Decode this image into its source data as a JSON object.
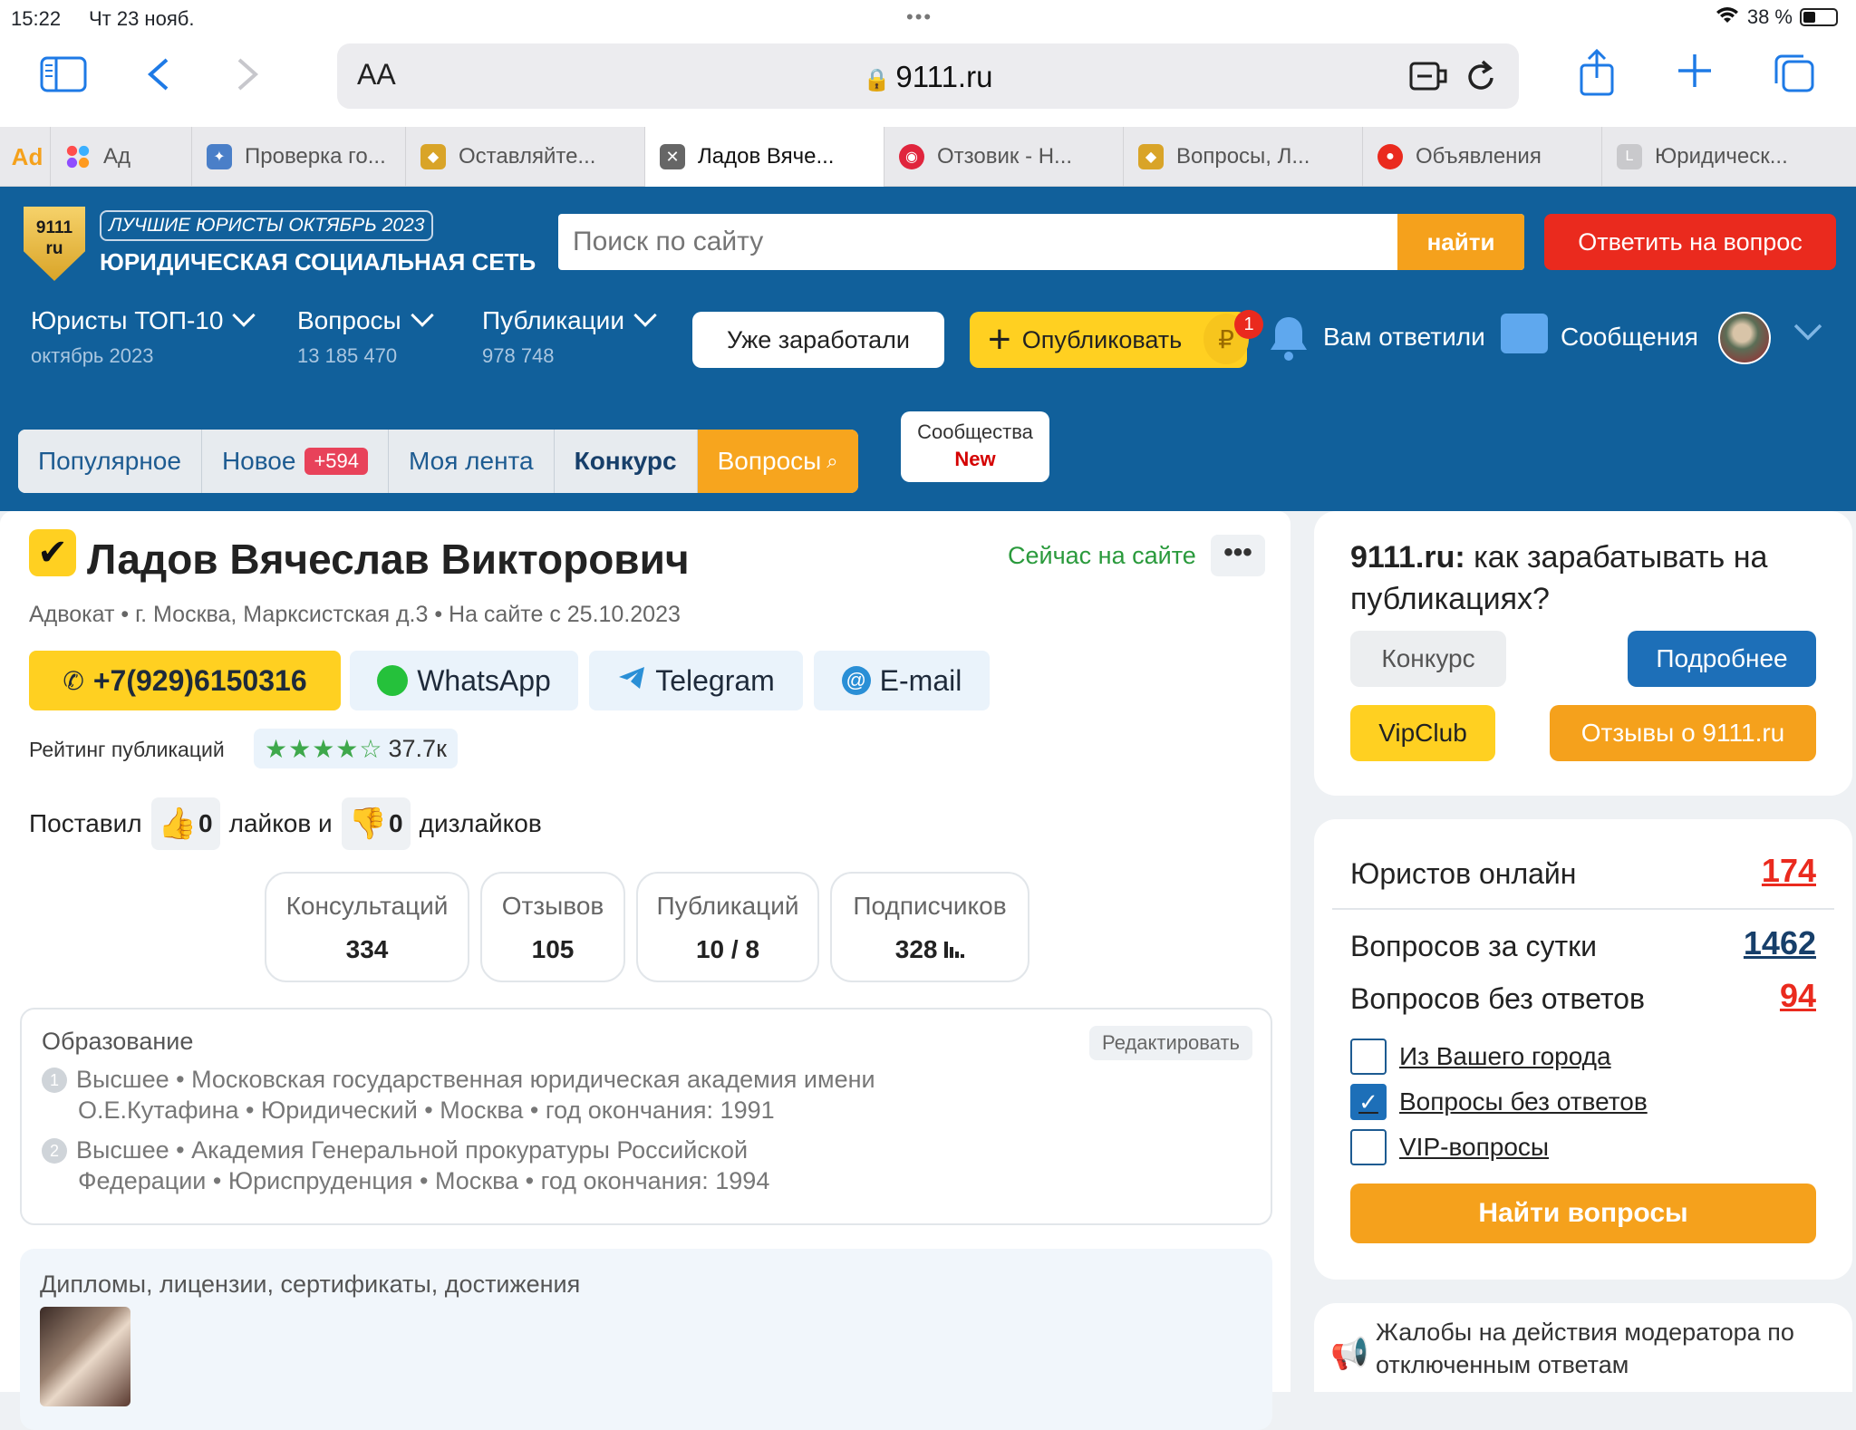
{
  "status": {
    "time": "15:22",
    "date": "Чт 23 нояб.",
    "battery": "38 %"
  },
  "browser": {
    "aa": "AA",
    "host": "9111.ru"
  },
  "tabs": [
    {
      "label": "",
      "color": "#f5a11c"
    },
    {
      "label": "Ад",
      "color": "#5aa0f0"
    },
    {
      "label": "Проверка го...",
      "color": "#4a7fc8"
    },
    {
      "label": "Оставляйте...",
      "color": "#d9a428"
    },
    {
      "label": "Ладов Вяче...",
      "color": "#666666"
    },
    {
      "label": "Отзовик - Н...",
      "color": "#e0253d"
    },
    {
      "label": "Вопросы, Л...",
      "color": "#d9a428"
    },
    {
      "label": "Объявления",
      "color": "#ea2a1e"
    },
    {
      "label": "Юридическ...",
      "color": "#c9c9cc"
    }
  ],
  "header": {
    "logo_top": "9111",
    "logo_bottom": "ru",
    "best": "ЛУЧШИЕ ЮРИСТЫ ОКТЯБРЬ 2023",
    "network": "ЮРИДИЧЕСКАЯ СОЦИАЛЬНАЯ СЕТЬ",
    "search_placeholder": "Поиск по сайту",
    "search_button": "найти",
    "answer_button": "Ответить на вопрос",
    "nav": [
      {
        "title": "Юристы ТОП-10",
        "sub": "октябрь 2023"
      },
      {
        "title": "Вопросы",
        "sub": "13 185 470"
      },
      {
        "title": "Публикации",
        "sub": "978 748"
      }
    ],
    "earned": "Уже заработали",
    "publish": "Опубликовать",
    "coin": "₽",
    "notif_count": "1",
    "answered": "Вам ответили",
    "messages": "Сообщения"
  },
  "subnav": {
    "items": [
      "Популярное",
      "Новое",
      "Моя лента",
      "Конкурс",
      "Вопросы"
    ],
    "new_count": "+594",
    "communities": "Сообщества",
    "communities_new": "New"
  },
  "profile": {
    "name": "Ладов Вячеслав Викторович",
    "online": "Сейчас на сайте",
    "meta": "Адвокат • г. Москва, Марксистская д.3 • На сайте с 25.10.2023",
    "phone": "+7(929)6150316",
    "whatsapp": "WhatsApp",
    "telegram": "Telegram",
    "email": "E-mail",
    "rating_label": "Рейтинг публикаций",
    "rating_stars": "★★★★☆",
    "rating_value": "37.7к",
    "likes_prefix": "Поставил",
    "likes": "0",
    "likes_mid": "лайков и",
    "dislikes": "0",
    "dislikes_suffix": "дизлайков",
    "stats": [
      {
        "label": "Консультаций",
        "value": "334"
      },
      {
        "label": "Отзывов",
        "value": "105"
      },
      {
        "label": "Публикаций",
        "value": "10 / 8"
      },
      {
        "label": "Подписчиков",
        "value": "328"
      }
    ],
    "education": {
      "title": "Образование",
      "edit": "Редактировать",
      "items": [
        {
          "num": "1",
          "line1": "Высшее • Московская государственная юридическая академия имени",
          "line2": "О.Е.Кутафина • Юридический • Москва • год окончания: 1991"
        },
        {
          "num": "2",
          "line1": "Высшее • Академия Генеральной прокуратуры Российской",
          "line2": "Федерации • Юриспруденция • Москва • год окончания: 1994"
        }
      ]
    },
    "diplomas_title": "Дипломы, лицензии, сертификаты, достижения"
  },
  "sidebar": {
    "promo_bold": "9111.ru:",
    "promo_text": " как зарабатывать на публикациях?",
    "konkurs": "Конкурс",
    "details": "Подробнее",
    "vipclub": "VipClub",
    "reviews": "Отзывы о 9111.ru",
    "lawyers_online_label": "Юристов онлайн",
    "lawyers_online": "174",
    "questions_day_label": "Вопросов за сутки",
    "questions_day": "1462",
    "unanswered_label": "Вопросов без ответов",
    "unanswered": "94",
    "filters": [
      {
        "label": "Из Вашего города",
        "checked": false
      },
      {
        "label": "Вопросы без ответов",
        "checked": true
      },
      {
        "label": "VIP-вопросы",
        "checked": false
      }
    ],
    "find": "Найти вопросы",
    "complaints": "Жалобы на действия модератора по отключенным ответам"
  },
  "colors": {
    "brand": "#11609b",
    "accent": "#f5a11c",
    "red": "#ea2a1e",
    "yellow": "#ffd021"
  }
}
